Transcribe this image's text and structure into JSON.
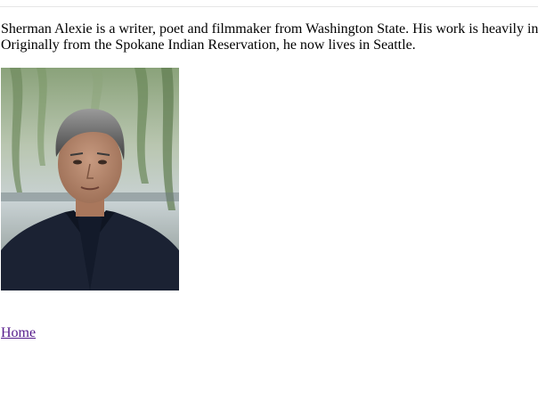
{
  "bio": {
    "line1": "Sherman Alexie is a writer, poet and filmmaker from Washington State. His work is heavily in",
    "line2": "Originally from the Spokane Indian Reservation, he now lives in Seattle."
  },
  "nav": {
    "home_label": "Home"
  },
  "colors": {
    "visited_link": "#551a8b",
    "text": "#000000",
    "background": "#ffffff",
    "rule": "#e6e6e6"
  }
}
